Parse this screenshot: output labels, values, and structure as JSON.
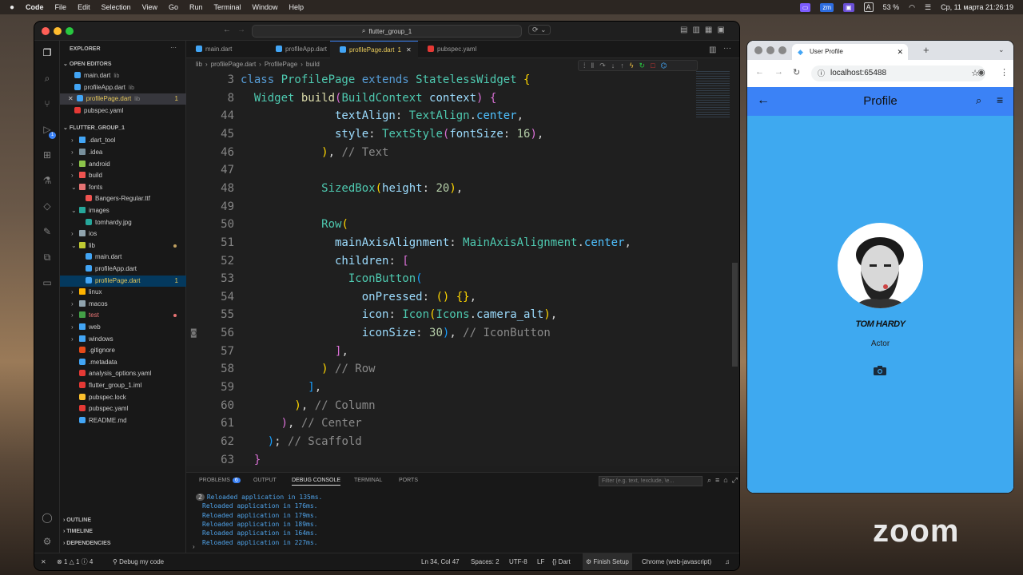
{
  "menubar": {
    "items": [
      "Code",
      "File",
      "Edit",
      "Selection",
      "View",
      "Go",
      "Run",
      "Terminal",
      "Window",
      "Help"
    ],
    "battery": "53 %",
    "keyboard": "A",
    "datetime": "Ср, 11 марта 21:26:19",
    "lang_chip": "zm"
  },
  "vscode": {
    "command_center": "flutter_group_1",
    "explorer": {
      "title": "EXPLORER",
      "open_editors_label": "OPEN EDITORS",
      "open_editors": [
        {
          "name": "main.dart",
          "hint": "lib",
          "badge": "",
          "color": "#42a5f5"
        },
        {
          "name": "profileApp.dart",
          "hint": "lib",
          "badge": "",
          "color": "#42a5f5"
        },
        {
          "name": "profilePage.dart",
          "hint": "lib",
          "badge": "1",
          "color": "#42a5f5"
        },
        {
          "name": "pubspec.yaml",
          "hint": "",
          "badge": "",
          "color": "#e53935"
        }
      ],
      "project_label": "FLUTTER_GROUP_1",
      "tree": [
        {
          "name": ".dart_tool",
          "indent": 1,
          "type": "folder",
          "color": "#42a5f5",
          "chev": "›"
        },
        {
          "name": ".idea",
          "indent": 1,
          "type": "folder",
          "color": "#78909c",
          "chev": "›"
        },
        {
          "name": "android",
          "indent": 1,
          "type": "folder",
          "color": "#8bc34a",
          "chev": "›"
        },
        {
          "name": "build",
          "indent": 1,
          "type": "folder",
          "color": "#ef5350",
          "chev": "›"
        },
        {
          "name": "fonts",
          "indent": 1,
          "type": "folder",
          "color": "#e57373",
          "chev": "⌄"
        },
        {
          "name": "Bangers-Regular.ttf",
          "indent": 2,
          "type": "file",
          "color": "#ef5350",
          "chev": ""
        },
        {
          "name": "images",
          "indent": 1,
          "type": "folder",
          "color": "#26a69a",
          "chev": "⌄"
        },
        {
          "name": "tomhardy.jpg",
          "indent": 2,
          "type": "file",
          "color": "#26a69a",
          "chev": ""
        },
        {
          "name": "ios",
          "indent": 1,
          "type": "folder",
          "color": "#90a4ae",
          "chev": "›"
        },
        {
          "name": "lib",
          "indent": 1,
          "type": "folder",
          "color": "#c0ca33",
          "chev": "⌄",
          "mod": true
        },
        {
          "name": "main.dart",
          "indent": 2,
          "type": "file",
          "color": "#42a5f5",
          "chev": ""
        },
        {
          "name": "profileApp.dart",
          "indent": 2,
          "type": "file",
          "color": "#42a5f5",
          "chev": ""
        },
        {
          "name": "profilePage.dart",
          "indent": 2,
          "type": "file",
          "color": "#42a5f5",
          "chev": "",
          "badge": "1",
          "selected": true
        },
        {
          "name": "linux",
          "indent": 1,
          "type": "folder",
          "color": "#ffb300",
          "chev": "›"
        },
        {
          "name": "macos",
          "indent": 1,
          "type": "folder",
          "color": "#90a4ae",
          "chev": "›"
        },
        {
          "name": "test",
          "indent": 1,
          "type": "folder",
          "color": "#43a047",
          "chev": "›",
          "mod": true,
          "red": true
        },
        {
          "name": "web",
          "indent": 1,
          "type": "folder",
          "color": "#42a5f5",
          "chev": "›"
        },
        {
          "name": "windows",
          "indent": 1,
          "type": "folder",
          "color": "#42a5f5",
          "chev": "›"
        },
        {
          "name": ".gitignore",
          "indent": 1,
          "type": "file",
          "color": "#e64a19",
          "chev": ""
        },
        {
          "name": ".metadata",
          "indent": 1,
          "type": "file",
          "color": "#42a5f5",
          "chev": ""
        },
        {
          "name": "analysis_options.yaml",
          "indent": 1,
          "type": "file",
          "color": "#e53935",
          "chev": ""
        },
        {
          "name": "flutter_group_1.iml",
          "indent": 1,
          "type": "file",
          "color": "#e53935",
          "chev": ""
        },
        {
          "name": "pubspec.lock",
          "indent": 1,
          "type": "file",
          "color": "#fbc02d",
          "chev": ""
        },
        {
          "name": "pubspec.yaml",
          "indent": 1,
          "type": "file",
          "color": "#e53935",
          "chev": ""
        },
        {
          "name": "README.md",
          "indent": 1,
          "type": "file",
          "color": "#42a5f5",
          "chev": ""
        }
      ],
      "outline": "OUTLINE",
      "timeline": "TIMELINE",
      "dependencies": "DEPENDENCIES"
    },
    "tabs": [
      {
        "label": "main.dart",
        "active": false
      },
      {
        "label": "profileApp.dart",
        "active": false
      },
      {
        "label": "profilePage.dart",
        "active": true,
        "badge": "1"
      },
      {
        "label": "pubspec.yaml",
        "active": false
      }
    ],
    "breadcrumb": [
      "lib",
      "profilePage.dart",
      "ProfilePage",
      "build"
    ],
    "code": [
      {
        "n": "3",
        "t": [
          [
            "class ",
            "#569cd6"
          ],
          [
            "ProfilePage ",
            "#4ec9b0"
          ],
          [
            "extends ",
            "#569cd6"
          ],
          [
            "StatelessWidget ",
            "#4ec9b0"
          ],
          [
            "{",
            "#ffd700"
          ]
        ]
      },
      {
        "n": "8",
        "t": [
          [
            "  Widget ",
            "#4ec9b0"
          ],
          [
            "build",
            "#dcdcaa"
          ],
          [
            "(",
            "#da70d6"
          ],
          [
            "BuildContext ",
            "#4ec9b0"
          ],
          [
            "context",
            "#9cdcfe"
          ],
          [
            ") ",
            "#da70d6"
          ],
          [
            "{",
            "#da70d6"
          ]
        ]
      },
      {
        "n": "44",
        "t": [
          [
            "              textAlign",
            "#9cdcfe"
          ],
          [
            ": ",
            "#d4d4d4"
          ],
          [
            "TextAlign",
            "#4ec9b0"
          ],
          [
            ".",
            "#d4d4d4"
          ],
          [
            "center",
            "#4fc1ff"
          ],
          [
            ",",
            "#d4d4d4"
          ]
        ]
      },
      {
        "n": "45",
        "t": [
          [
            "              style",
            "#9cdcfe"
          ],
          [
            ": ",
            "#d4d4d4"
          ],
          [
            "TextStyle",
            "#4ec9b0"
          ],
          [
            "(",
            "#da70d6"
          ],
          [
            "fontSize",
            "#9cdcfe"
          ],
          [
            ": ",
            "#d4d4d4"
          ],
          [
            "16",
            "#b5cea8"
          ],
          [
            ")",
            "#da70d6"
          ],
          [
            ",",
            "#d4d4d4"
          ]
        ]
      },
      {
        "n": "46",
        "t": [
          [
            "            )",
            "#ffd700"
          ],
          [
            ", ",
            "#d4d4d4"
          ],
          [
            "// Text",
            "#8a8a8a"
          ]
        ]
      },
      {
        "n": "47",
        "t": [
          [
            "",
            "#d4d4d4"
          ]
        ]
      },
      {
        "n": "48",
        "t": [
          [
            "            SizedBox",
            "#4ec9b0"
          ],
          [
            "(",
            "#ffd700"
          ],
          [
            "height",
            "#9cdcfe"
          ],
          [
            ": ",
            "#d4d4d4"
          ],
          [
            "20",
            "#b5cea8"
          ],
          [
            ")",
            "#ffd700"
          ],
          [
            ",",
            "#d4d4d4"
          ]
        ]
      },
      {
        "n": "49",
        "t": [
          [
            "",
            "#d4d4d4"
          ]
        ]
      },
      {
        "n": "50",
        "t": [
          [
            "            Row",
            "#4ec9b0"
          ],
          [
            "(",
            "#ffd700"
          ]
        ]
      },
      {
        "n": "51",
        "t": [
          [
            "              mainAxisAlignment",
            "#9cdcfe"
          ],
          [
            ": ",
            "#d4d4d4"
          ],
          [
            "MainAxisAlignment",
            "#4ec9b0"
          ],
          [
            ".",
            "#d4d4d4"
          ],
          [
            "center",
            "#4fc1ff"
          ],
          [
            ",",
            "#d4d4d4"
          ]
        ]
      },
      {
        "n": "52",
        "t": [
          [
            "              children",
            "#9cdcfe"
          ],
          [
            ": ",
            "#d4d4d4"
          ],
          [
            "[",
            "#da70d6"
          ]
        ]
      },
      {
        "n": "53",
        "t": [
          [
            "                IconButton",
            "#4ec9b0"
          ],
          [
            "(",
            "#179fff"
          ]
        ]
      },
      {
        "n": "54",
        "t": [
          [
            "                  onPressed",
            "#9cdcfe"
          ],
          [
            ": ",
            "#d4d4d4"
          ],
          [
            "() {}",
            "#ffd700"
          ],
          [
            ",",
            "#d4d4d4"
          ]
        ]
      },
      {
        "n": "55",
        "t": [
          [
            "                  icon",
            "#9cdcfe"
          ],
          [
            ": ",
            "#d4d4d4"
          ],
          [
            "Icon",
            "#4ec9b0"
          ],
          [
            "(",
            "#ffd700"
          ],
          [
            "Icons",
            "#4ec9b0"
          ],
          [
            ".",
            "#d4d4d4"
          ],
          [
            "camera_alt",
            "#9cdcfe"
          ],
          [
            ")",
            "#ffd700"
          ],
          [
            ",",
            "#d4d4d4"
          ]
        ]
      },
      {
        "n": "56",
        "t": [
          [
            "                  iconSize",
            "#9cdcfe"
          ],
          [
            ": ",
            "#d4d4d4"
          ],
          [
            "30",
            "#b5cea8"
          ],
          [
            ")",
            "#179fff"
          ],
          [
            ", ",
            "#d4d4d4"
          ],
          [
            "// IconButton",
            "#8a8a8a"
          ]
        ]
      },
      {
        "n": "57",
        "t": [
          [
            "              ]",
            "#da70d6"
          ],
          [
            ",",
            "#d4d4d4"
          ]
        ]
      },
      {
        "n": "58",
        "t": [
          [
            "            ) ",
            "#ffd700"
          ],
          [
            "// Row",
            "#8a8a8a"
          ]
        ]
      },
      {
        "n": "59",
        "t": [
          [
            "          ]",
            "#179fff"
          ],
          [
            ",",
            "#d4d4d4"
          ]
        ]
      },
      {
        "n": "60",
        "t": [
          [
            "        )",
            "#ffd700"
          ],
          [
            ", ",
            "#d4d4d4"
          ],
          [
            "// Column",
            "#8a8a8a"
          ]
        ]
      },
      {
        "n": "61",
        "t": [
          [
            "      )",
            "#da70d6"
          ],
          [
            ", ",
            "#d4d4d4"
          ],
          [
            "// Center",
            "#8a8a8a"
          ]
        ]
      },
      {
        "n": "62",
        "t": [
          [
            "    )",
            "#179fff"
          ],
          [
            "; ",
            "#d4d4d4"
          ],
          [
            "// Scaffold",
            "#8a8a8a"
          ]
        ]
      },
      {
        "n": "63",
        "t": [
          [
            "  }",
            "#da70d6"
          ]
        ]
      }
    ],
    "panel": {
      "tabs": [
        "PROBLEMS",
        "OUTPUT",
        "DEBUG CONSOLE",
        "TERMINAL",
        "PORTS"
      ],
      "problems_count": "6",
      "filter_placeholder": "Filter (e.g. text, !exclude, \\e...",
      "lines": [
        {
          "count": "2",
          "text": "Reloaded application in 135ms."
        },
        {
          "count": "",
          "text": "Reloaded application in 176ms."
        },
        {
          "count": "",
          "text": "Reloaded application in 179ms."
        },
        {
          "count": "",
          "text": "Reloaded application in 189ms."
        },
        {
          "count": "",
          "text": "Reloaded application in 164ms."
        },
        {
          "count": "",
          "text": "Reloaded application in 227ms."
        }
      ]
    },
    "status": {
      "errors": "1",
      "warnings": "1",
      "info": "4",
      "debug": "Debug my code",
      "position": "Ln 34, Col 47",
      "spaces": "Spaces: 2",
      "encoding": "UTF-8",
      "eol": "LF",
      "lang": "{} Dart",
      "finish": "Finish Setup",
      "device": "Chrome (web-javascript)"
    }
  },
  "chrome": {
    "tab_title": "User Profile",
    "url": "localhost:65488",
    "app": {
      "title": "Profile",
      "name": "TOM HARDY",
      "role": "Actor"
    }
  },
  "zoom_watermark": "zoom",
  "colors": {
    "accent": "#3b82f6",
    "app_bg": "#3ea9f0"
  }
}
